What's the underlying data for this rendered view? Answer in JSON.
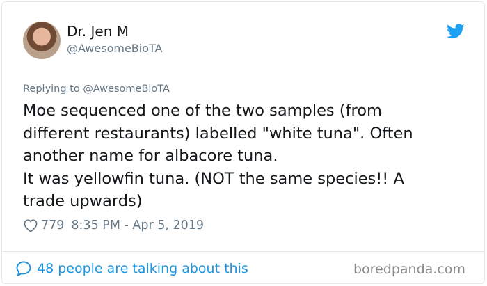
{
  "author": {
    "name": "Dr. Jen M",
    "handle": "@AwesomeBioTA"
  },
  "replying_to": "Replying to @AwesomeBioTA",
  "tweet_lines": [
    "Moe sequenced one of the two samples (from",
    "different restaurants) labelled \"white tuna\". Often",
    "another name for albacore tuna.",
    "It was yellowfin tuna. (NOT the same species!! A",
    "trade upwards)"
  ],
  "meta": {
    "likes": "779",
    "timestamp": "8:35 PM - Apr 5, 2019"
  },
  "footer": {
    "talking": "48 people are talking about this"
  },
  "watermark": "boredpanda.com",
  "icons": {
    "brand": "twitter-bird-icon",
    "like": "heart-icon",
    "reply": "speech-bubble-icon"
  },
  "colors": {
    "twitter_blue": "#1da1f2",
    "link_blue": "#1b95e0",
    "muted": "#657786",
    "text": "#14171a"
  }
}
